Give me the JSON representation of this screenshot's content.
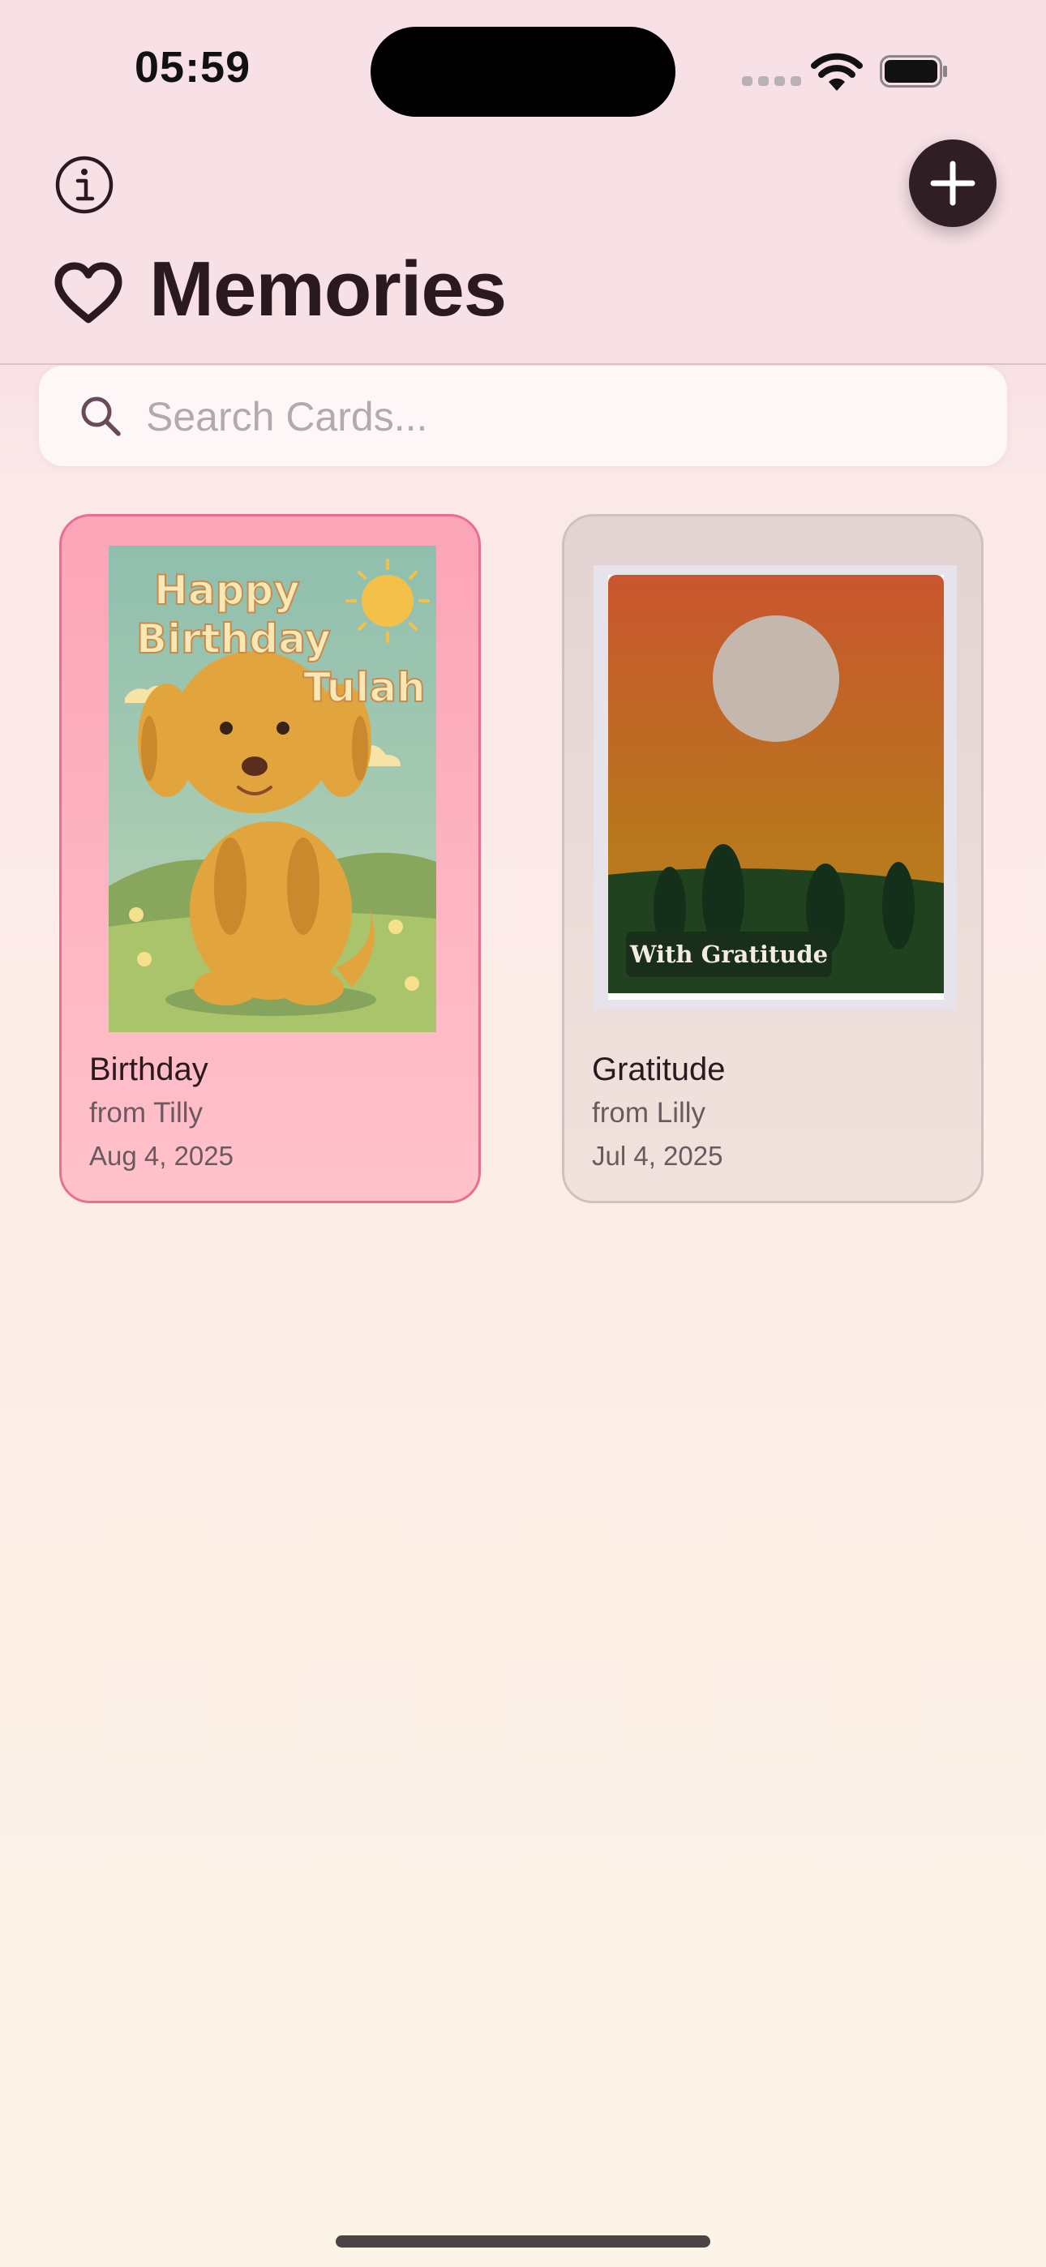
{
  "status_bar": {
    "time": "05:59"
  },
  "header": {
    "title": "Memories"
  },
  "search": {
    "placeholder": "Search Cards..."
  },
  "cards": [
    {
      "title": "Birthday",
      "from": "from Tilly",
      "date": "Aug 4, 2025",
      "image_text": [
        "Happy",
        "Birthday",
        "Tulah"
      ]
    },
    {
      "title": "Gratitude",
      "from": "from Lilly",
      "date": "Jul 4, 2025",
      "image_text": "With Gratitude"
    }
  ],
  "icons": {
    "info": "info-icon",
    "add": "plus-icon",
    "title": "heart-icon",
    "search": "search-icon",
    "wifi": "wifi-icon",
    "battery": "battery-icon"
  },
  "colors": {
    "accent_dark": "#2f1f24",
    "card_selected_fill": "#fca4b8",
    "card_selected_border": "#ea6e8e",
    "card_fill": "#e3d3d3"
  }
}
